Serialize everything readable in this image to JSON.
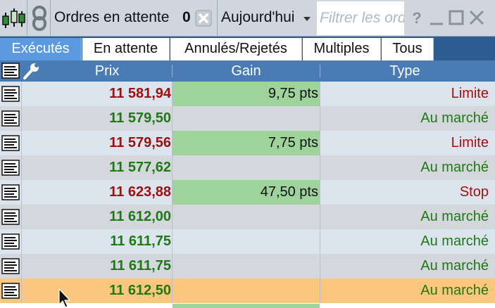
{
  "toolbar": {
    "title": "Ordres en attente",
    "pending_count": "0",
    "period_label": "Aujourd'hui",
    "filter_placeholder": "Filtrer les ordres",
    "icons": [
      "candlestick-chart-icon",
      "link-icon",
      "clear-icon",
      "help-icon",
      "minimize-icon",
      "maximize-icon",
      "close-icon"
    ]
  },
  "tabs": [
    {
      "label": "Exécutés",
      "active": true
    },
    {
      "label": "En attente",
      "active": false
    },
    {
      "label": "Annulés/Rejetés",
      "active": false
    },
    {
      "label": "Multiples",
      "active": false
    },
    {
      "label": "Tous",
      "active": false
    }
  ],
  "table": {
    "columns": {
      "price": "Prix",
      "gain": "Gain",
      "type": "Type"
    },
    "header_icons": [
      "list-icon",
      "wrench-icon"
    ],
    "rows": [
      {
        "price": "11 581,94",
        "price_color": "red",
        "gain": "9,75 pts",
        "type": "Limite",
        "type_color": "red",
        "selected": false
      },
      {
        "price": "11 579,50",
        "price_color": "green",
        "gain": "",
        "type": "Au marché",
        "type_color": "green",
        "selected": false
      },
      {
        "price": "11 579,56",
        "price_color": "red",
        "gain": "7,75 pts",
        "type": "Limite",
        "type_color": "red",
        "selected": false
      },
      {
        "price": "11 577,62",
        "price_color": "green",
        "gain": "",
        "type": "Au marché",
        "type_color": "green",
        "selected": false
      },
      {
        "price": "11 623,88",
        "price_color": "red",
        "gain": "47,50 pts",
        "type": "Stop",
        "type_color": "red",
        "selected": false
      },
      {
        "price": "11 612,00",
        "price_color": "green",
        "gain": "",
        "type": "Au marché",
        "type_color": "green",
        "selected": false
      },
      {
        "price": "11 611,75",
        "price_color": "green",
        "gain": "",
        "type": "Au marché",
        "type_color": "green",
        "selected": false
      },
      {
        "price": "11 611,75",
        "price_color": "green",
        "gain": "",
        "type": "Au marché",
        "type_color": "green",
        "selected": false
      },
      {
        "price": "11 612,50",
        "price_color": "green",
        "gain": "",
        "type": "Au marché",
        "type_color": "green",
        "selected": true
      }
    ]
  },
  "colors": {
    "red": "#a01010",
    "green": "#1d7a15",
    "gain_fill": "#9ed39c",
    "selected_row": "#fbc77c",
    "active_tab": "#5b9ae0",
    "header": "#4a7bb5"
  }
}
